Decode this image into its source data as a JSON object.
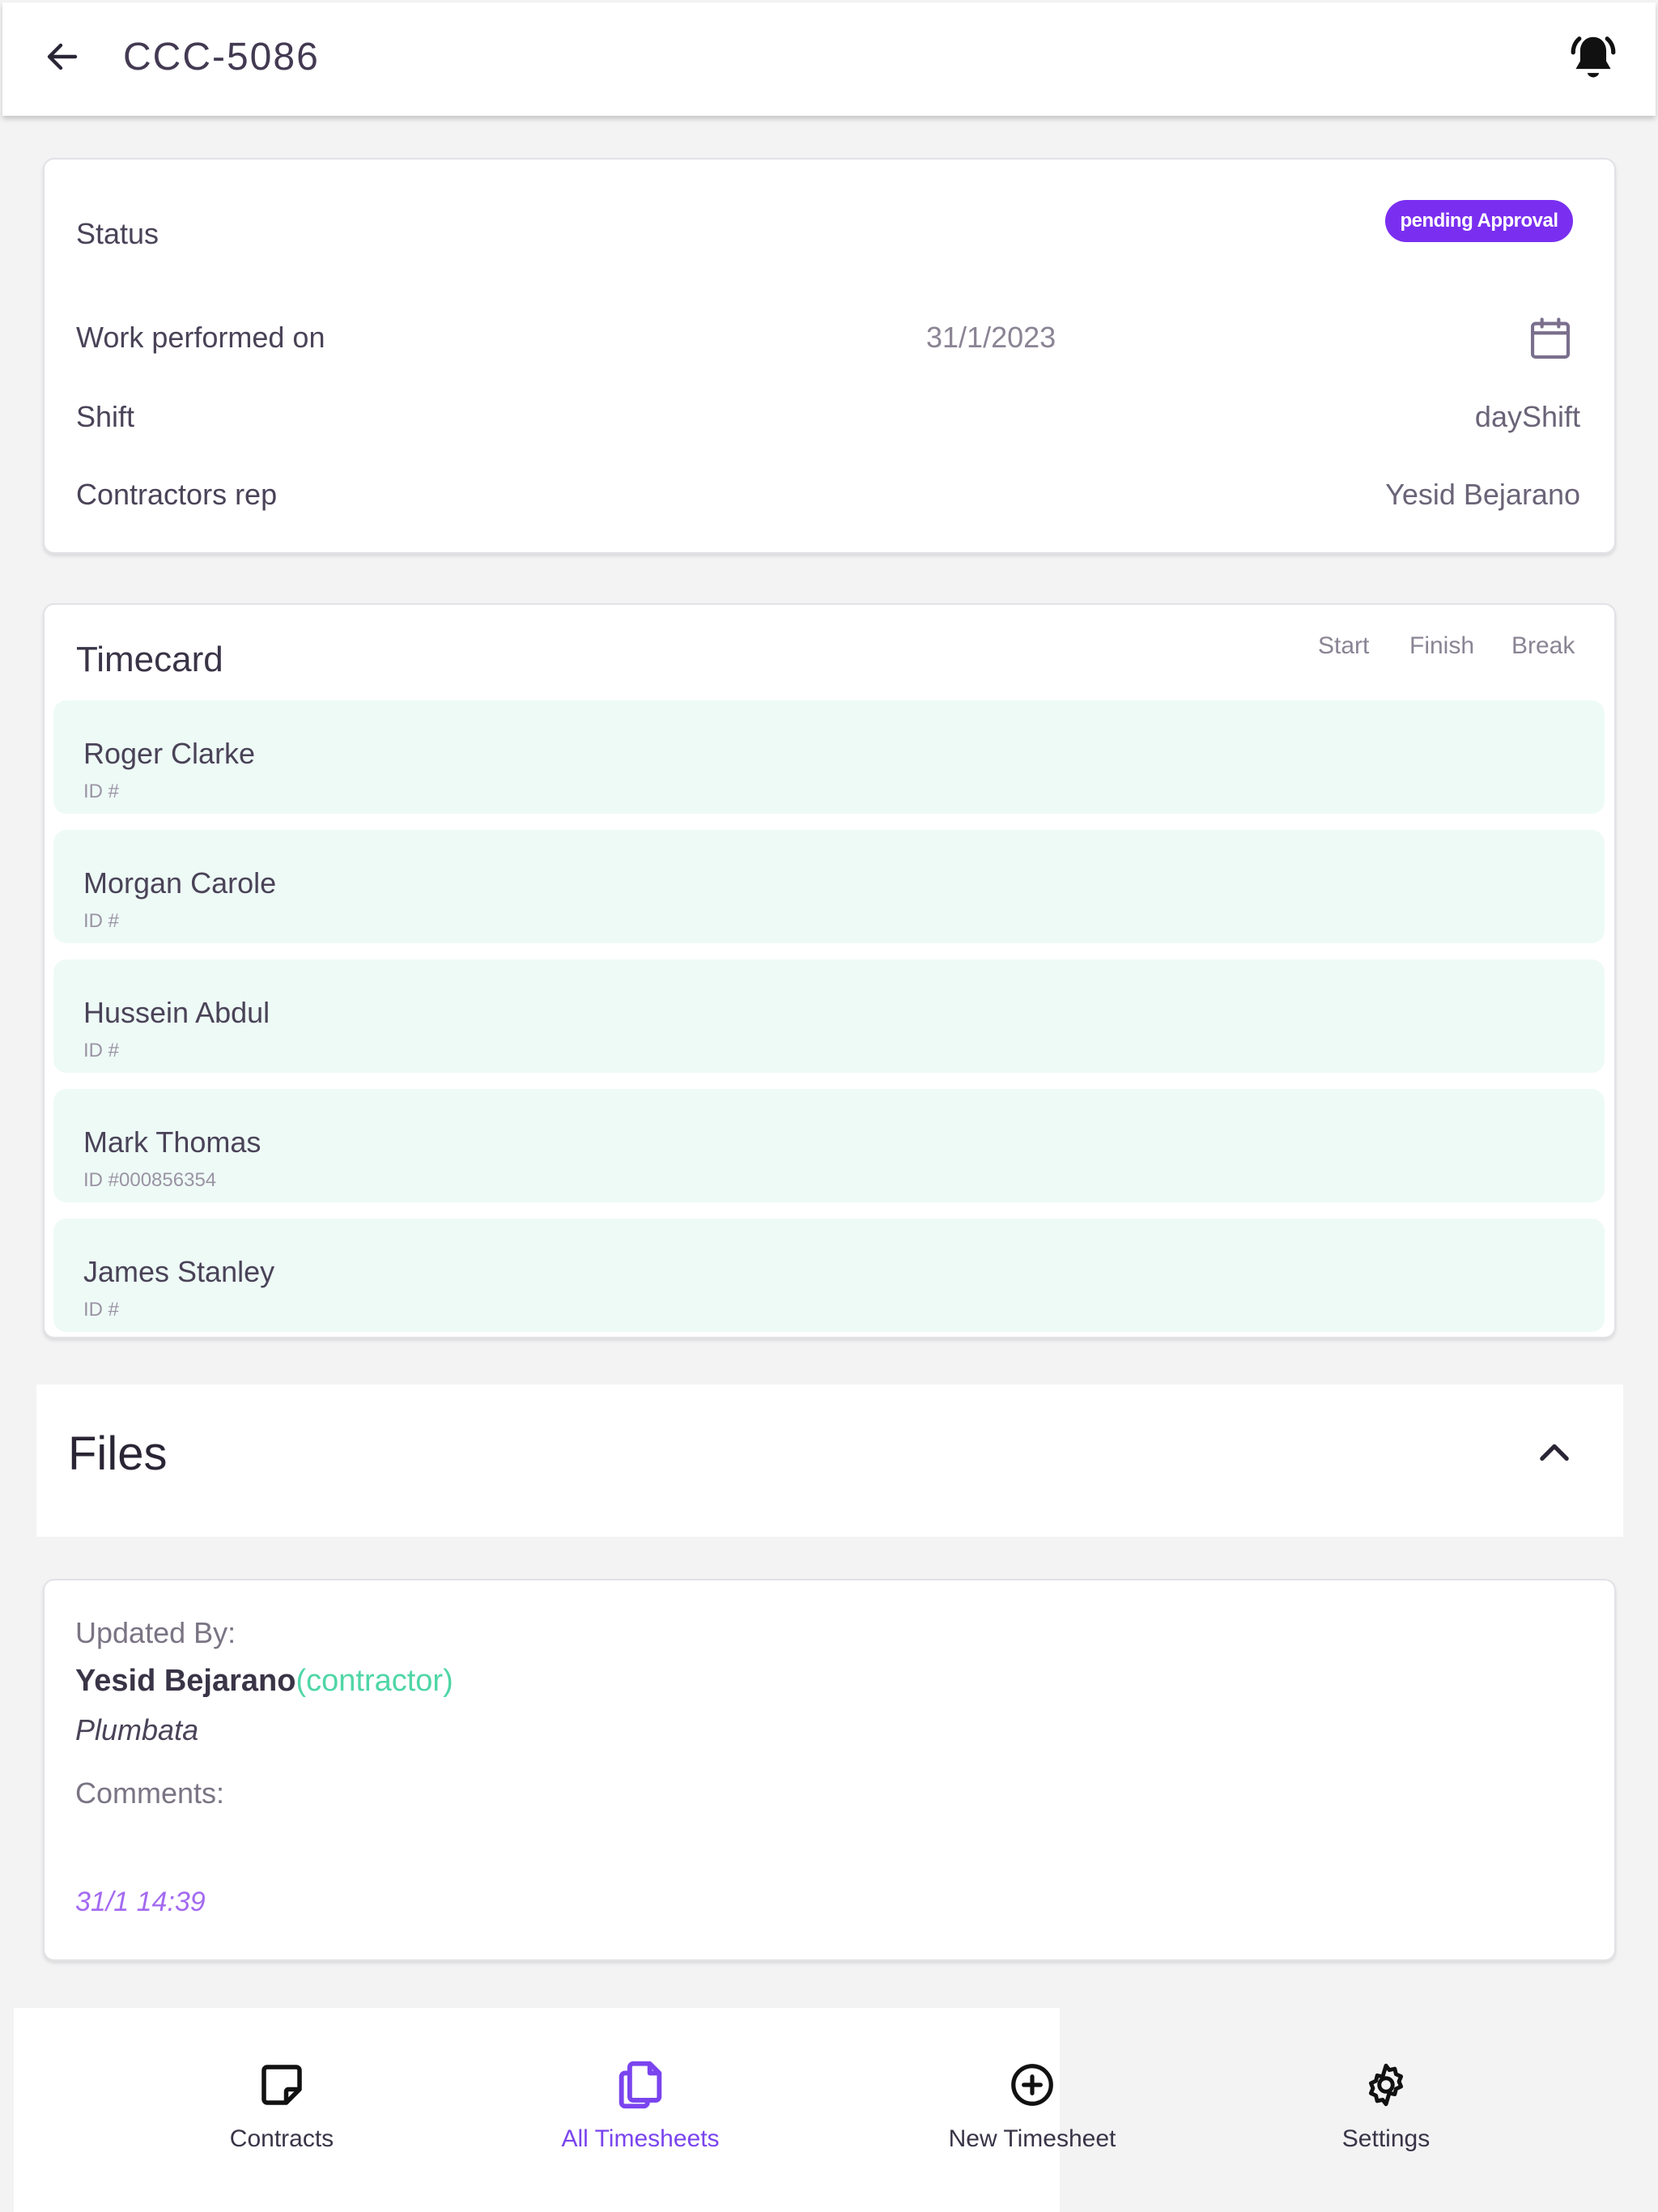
{
  "header": {
    "title": "CCC-5086"
  },
  "details": {
    "status_label": "Status",
    "status_value": "pending Approval",
    "work_label": "Work performed on",
    "work_date": "31/1/2023",
    "shift_label": "Shift",
    "shift_value": "dayShift",
    "rep_label": "Contractors rep",
    "rep_value": "Yesid Bejarano"
  },
  "timecard": {
    "title": "Timecard",
    "columns": [
      "Start",
      "Finish",
      "Break"
    ],
    "workers": [
      {
        "name": "Roger Clarke",
        "id": "ID #"
      },
      {
        "name": "Morgan Carole",
        "id": "ID #"
      },
      {
        "name": "Hussein Abdul",
        "id": "ID #"
      },
      {
        "name": "Mark Thomas",
        "id": "ID #000856354"
      },
      {
        "name": "James Stanley",
        "id": "ID #"
      }
    ]
  },
  "files": {
    "title": "Files"
  },
  "update": {
    "updated_by_label": "Updated By:",
    "updater_name": "Yesid Bejarano",
    "updater_role": "(contractor)",
    "company": "Plumbata",
    "comments_label": "Comments:",
    "timestamp": "31/1 14:39"
  },
  "nav": [
    {
      "label": "Contracts",
      "icon": "note-icon"
    },
    {
      "label": "All Timesheets",
      "icon": "copy-icon"
    },
    {
      "label": "New Timesheet",
      "icon": "plus-circle-icon"
    },
    {
      "label": "Settings",
      "icon": "gear-icon"
    }
  ],
  "colors": {
    "accent": "#7a2ff0",
    "row_bg": "#eefaf6",
    "role": "#4fd6a6"
  }
}
